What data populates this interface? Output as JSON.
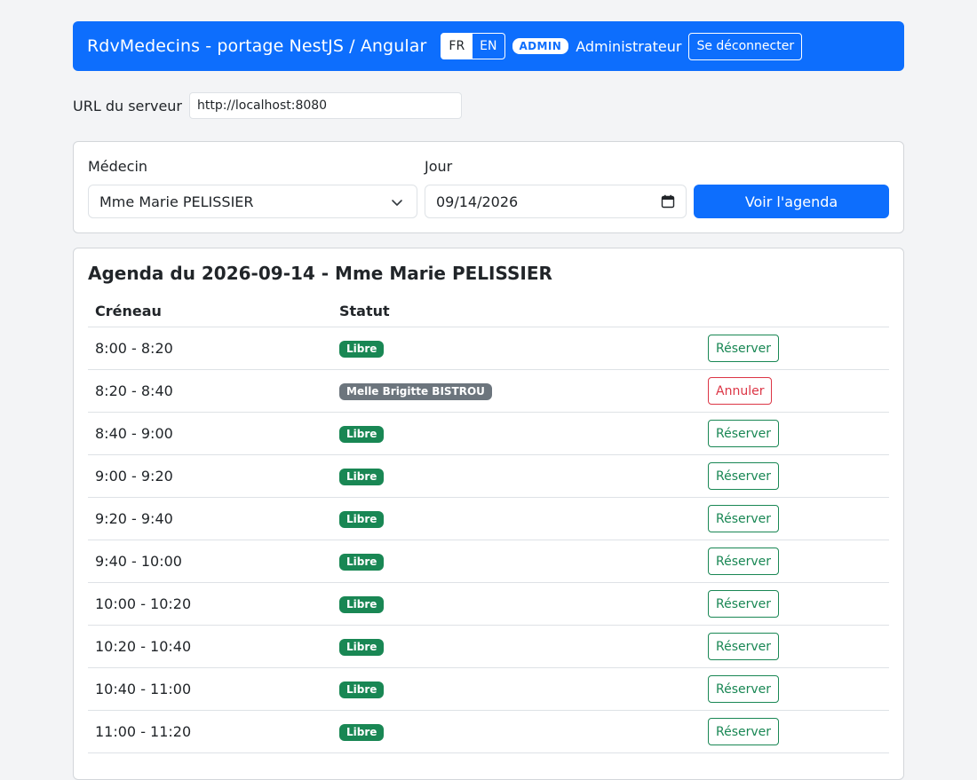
{
  "navbar": {
    "brand": "RdvMedecins - portage NestJS / Angular",
    "lang_fr": "FR",
    "lang_en": "EN",
    "role_badge": "ADMIN",
    "user_name": "Administrateur",
    "logout": "Se déconnecter"
  },
  "server": {
    "label": "URL du serveur",
    "value": "http://localhost:8080"
  },
  "form": {
    "doctor_label": "Médecin",
    "doctor_value": "Mme Marie PELISSIER",
    "day_label": "Jour",
    "day_value": "09/14/2026",
    "submit": "Voir l'agenda"
  },
  "agenda": {
    "title": "Agenda du 2026-09-14 - Mme Marie PELISSIER",
    "col_slot": "Créneau",
    "col_status": "Statut",
    "rows": [
      {
        "slot": "8:00 - 8:20",
        "status": "Libre",
        "action": "Réserver"
      },
      {
        "slot": "8:20 - 8:40",
        "status": "Melle Brigitte BISTROU",
        "action": "Annuler"
      },
      {
        "slot": "8:40 - 9:00",
        "status": "Libre",
        "action": "Réserver"
      },
      {
        "slot": "9:00 - 9:20",
        "status": "Libre",
        "action": "Réserver"
      },
      {
        "slot": "9:20 - 9:40",
        "status": "Libre",
        "action": "Réserver"
      },
      {
        "slot": "9:40 - 10:00",
        "status": "Libre",
        "action": "Réserver"
      },
      {
        "slot": "10:00 - 10:20",
        "status": "Libre",
        "action": "Réserver"
      },
      {
        "slot": "10:20 - 10:40",
        "status": "Libre",
        "action": "Réserver"
      },
      {
        "slot": "10:40 - 11:00",
        "status": "Libre",
        "action": "Réserver"
      },
      {
        "slot": "11:00 - 11:20",
        "status": "Libre",
        "action": "Réserver"
      }
    ]
  },
  "colors": {
    "primary": "#0d6efd",
    "success": "#198754",
    "danger": "#dc3545",
    "secondary": "#6c757d",
    "background": "#f3f4f6"
  },
  "icons": {
    "select_chevron": "chevron-down-icon",
    "date_picker": "calendar-icon"
  }
}
